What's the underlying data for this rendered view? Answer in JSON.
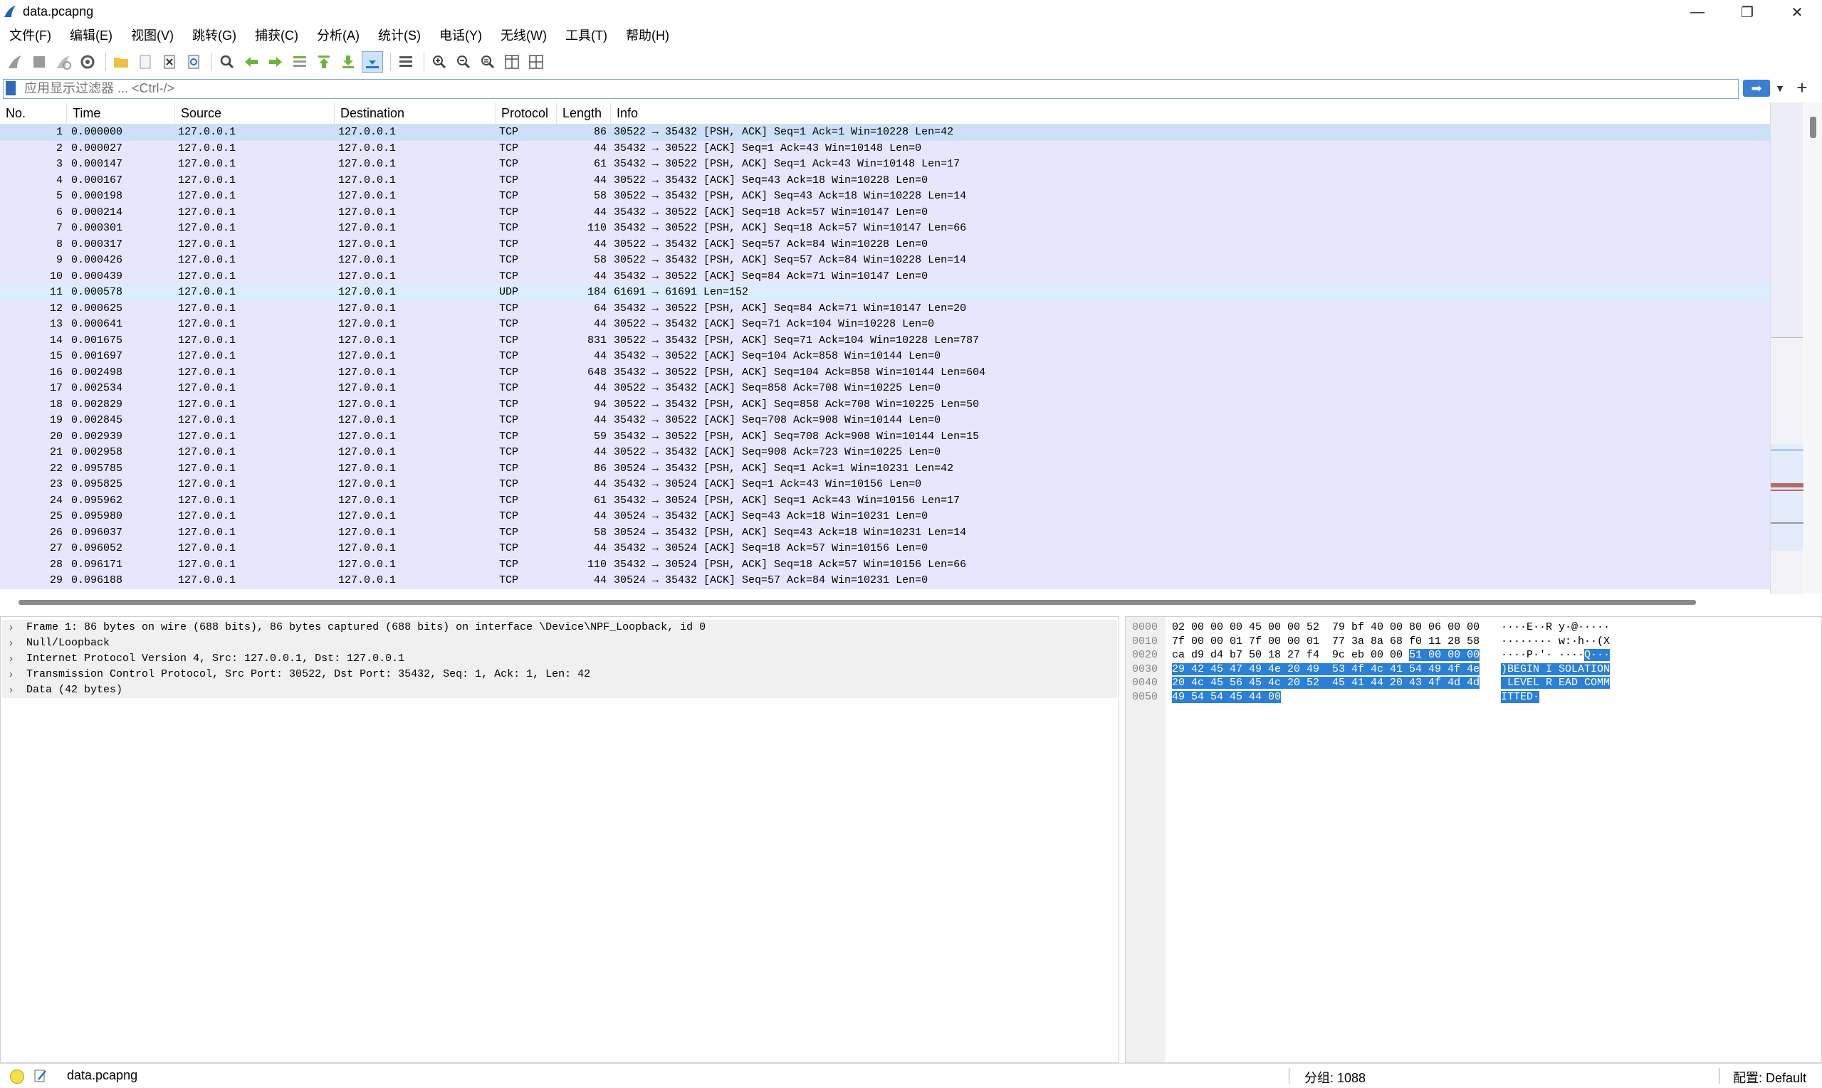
{
  "window": {
    "title": "data.pcapng",
    "minimize": "—",
    "restore": "❐",
    "close": "✕"
  },
  "menu": [
    "文件(F)",
    "编辑(E)",
    "视图(V)",
    "跳转(G)",
    "捕获(C)",
    "分析(A)",
    "统计(S)",
    "电话(Y)",
    "无线(W)",
    "工具(T)",
    "帮助(H)"
  ],
  "filter": {
    "placeholder": "应用显示过滤器 ... <Ctrl-/>",
    "apply_icon": "arrow-right-icon",
    "add_label": "+"
  },
  "columns": [
    "No.",
    "Time",
    "Source",
    "Destination",
    "Protocol",
    "Length",
    "Info"
  ],
  "packets": [
    {
      "no": "1",
      "time": "0.000000",
      "src": "127.0.0.1",
      "dst": "127.0.0.1",
      "proto": "TCP",
      "len": "86",
      "info": "30522 → 35432 [PSH, ACK] Seq=1 Ack=1 Win=10228 Len=42"
    },
    {
      "no": "2",
      "time": "0.000027",
      "src": "127.0.0.1",
      "dst": "127.0.0.1",
      "proto": "TCP",
      "len": "44",
      "info": "35432 → 30522 [ACK] Seq=1 Ack=43 Win=10148 Len=0"
    },
    {
      "no": "3",
      "time": "0.000147",
      "src": "127.0.0.1",
      "dst": "127.0.0.1",
      "proto": "TCP",
      "len": "61",
      "info": "35432 → 30522 [PSH, ACK] Seq=1 Ack=43 Win=10148 Len=17"
    },
    {
      "no": "4",
      "time": "0.000167",
      "src": "127.0.0.1",
      "dst": "127.0.0.1",
      "proto": "TCP",
      "len": "44",
      "info": "30522 → 35432 [ACK] Seq=43 Ack=18 Win=10228 Len=0"
    },
    {
      "no": "5",
      "time": "0.000198",
      "src": "127.0.0.1",
      "dst": "127.0.0.1",
      "proto": "TCP",
      "len": "58",
      "info": "30522 → 35432 [PSH, ACK] Seq=43 Ack=18 Win=10228 Len=14"
    },
    {
      "no": "6",
      "time": "0.000214",
      "src": "127.0.0.1",
      "dst": "127.0.0.1",
      "proto": "TCP",
      "len": "44",
      "info": "35432 → 30522 [ACK] Seq=18 Ack=57 Win=10147 Len=0"
    },
    {
      "no": "7",
      "time": "0.000301",
      "src": "127.0.0.1",
      "dst": "127.0.0.1",
      "proto": "TCP",
      "len": "110",
      "info": "35432 → 30522 [PSH, ACK] Seq=18 Ack=57 Win=10147 Len=66"
    },
    {
      "no": "8",
      "time": "0.000317",
      "src": "127.0.0.1",
      "dst": "127.0.0.1",
      "proto": "TCP",
      "len": "44",
      "info": "30522 → 35432 [ACK] Seq=57 Ack=84 Win=10228 Len=0"
    },
    {
      "no": "9",
      "time": "0.000426",
      "src": "127.0.0.1",
      "dst": "127.0.0.1",
      "proto": "TCP",
      "len": "58",
      "info": "30522 → 35432 [PSH, ACK] Seq=57 Ack=84 Win=10228 Len=14"
    },
    {
      "no": "10",
      "time": "0.000439",
      "src": "127.0.0.1",
      "dst": "127.0.0.1",
      "proto": "TCP",
      "len": "44",
      "info": "35432 → 30522 [ACK] Seq=84 Ack=71 Win=10147 Len=0"
    },
    {
      "no": "11",
      "time": "0.000578",
      "src": "127.0.0.1",
      "dst": "127.0.0.1",
      "proto": "UDP",
      "len": "184",
      "info": "61691 → 61691 Len=152"
    },
    {
      "no": "12",
      "time": "0.000625",
      "src": "127.0.0.1",
      "dst": "127.0.0.1",
      "proto": "TCP",
      "len": "64",
      "info": "35432 → 30522 [PSH, ACK] Seq=84 Ack=71 Win=10147 Len=20"
    },
    {
      "no": "13",
      "time": "0.000641",
      "src": "127.0.0.1",
      "dst": "127.0.0.1",
      "proto": "TCP",
      "len": "44",
      "info": "30522 → 35432 [ACK] Seq=71 Ack=104 Win=10228 Len=0"
    },
    {
      "no": "14",
      "time": "0.001675",
      "src": "127.0.0.1",
      "dst": "127.0.0.1",
      "proto": "TCP",
      "len": "831",
      "info": "30522 → 35432 [PSH, ACK] Seq=71 Ack=104 Win=10228 Len=787"
    },
    {
      "no": "15",
      "time": "0.001697",
      "src": "127.0.0.1",
      "dst": "127.0.0.1",
      "proto": "TCP",
      "len": "44",
      "info": "35432 → 30522 [ACK] Seq=104 Ack=858 Win=10144 Len=0"
    },
    {
      "no": "16",
      "time": "0.002498",
      "src": "127.0.0.1",
      "dst": "127.0.0.1",
      "proto": "TCP",
      "len": "648",
      "info": "35432 → 30522 [PSH, ACK] Seq=104 Ack=858 Win=10144 Len=604"
    },
    {
      "no": "17",
      "time": "0.002534",
      "src": "127.0.0.1",
      "dst": "127.0.0.1",
      "proto": "TCP",
      "len": "44",
      "info": "30522 → 35432 [ACK] Seq=858 Ack=708 Win=10225 Len=0"
    },
    {
      "no": "18",
      "time": "0.002829",
      "src": "127.0.0.1",
      "dst": "127.0.0.1",
      "proto": "TCP",
      "len": "94",
      "info": "30522 → 35432 [PSH, ACK] Seq=858 Ack=708 Win=10225 Len=50"
    },
    {
      "no": "19",
      "time": "0.002845",
      "src": "127.0.0.1",
      "dst": "127.0.0.1",
      "proto": "TCP",
      "len": "44",
      "info": "35432 → 30522 [ACK] Seq=708 Ack=908 Win=10144 Len=0"
    },
    {
      "no": "20",
      "time": "0.002939",
      "src": "127.0.0.1",
      "dst": "127.0.0.1",
      "proto": "TCP",
      "len": "59",
      "info": "35432 → 30522 [PSH, ACK] Seq=708 Ack=908 Win=10144 Len=15"
    },
    {
      "no": "21",
      "time": "0.002958",
      "src": "127.0.0.1",
      "dst": "127.0.0.1",
      "proto": "TCP",
      "len": "44",
      "info": "30522 → 35432 [ACK] Seq=908 Ack=723 Win=10225 Len=0"
    },
    {
      "no": "22",
      "time": "0.095785",
      "src": "127.0.0.1",
      "dst": "127.0.0.1",
      "proto": "TCP",
      "len": "86",
      "info": "30524 → 35432 [PSH, ACK] Seq=1 Ack=1 Win=10231 Len=42"
    },
    {
      "no": "23",
      "time": "0.095825",
      "src": "127.0.0.1",
      "dst": "127.0.0.1",
      "proto": "TCP",
      "len": "44",
      "info": "35432 → 30524 [ACK] Seq=1 Ack=43 Win=10156 Len=0"
    },
    {
      "no": "24",
      "time": "0.095962",
      "src": "127.0.0.1",
      "dst": "127.0.0.1",
      "proto": "TCP",
      "len": "61",
      "info": "35432 → 30524 [PSH, ACK] Seq=1 Ack=43 Win=10156 Len=17"
    },
    {
      "no": "25",
      "time": "0.095980",
      "src": "127.0.0.1",
      "dst": "127.0.0.1",
      "proto": "TCP",
      "len": "44",
      "info": "30524 → 35432 [ACK] Seq=43 Ack=18 Win=10231 Len=0"
    },
    {
      "no": "26",
      "time": "0.096037",
      "src": "127.0.0.1",
      "dst": "127.0.0.1",
      "proto": "TCP",
      "len": "58",
      "info": "30524 → 35432 [PSH, ACK] Seq=43 Ack=18 Win=10231 Len=14"
    },
    {
      "no": "27",
      "time": "0.096052",
      "src": "127.0.0.1",
      "dst": "127.0.0.1",
      "proto": "TCP",
      "len": "44",
      "info": "35432 → 30524 [ACK] Seq=18 Ack=57 Win=10156 Len=0"
    },
    {
      "no": "28",
      "time": "0.096171",
      "src": "127.0.0.1",
      "dst": "127.0.0.1",
      "proto": "TCP",
      "len": "110",
      "info": "35432 → 30524 [PSH, ACK] Seq=18 Ack=57 Win=10156 Len=66"
    },
    {
      "no": "29",
      "time": "0.096188",
      "src": "127.0.0.1",
      "dst": "127.0.0.1",
      "proto": "TCP",
      "len": "44",
      "info": "30524 → 35432 [ACK] Seq=57 Ack=84 Win=10231 Len=0"
    }
  ],
  "details": [
    "Frame 1: 86 bytes on wire (688 bits), 86 bytes captured (688 bits) on interface \\Device\\NPF_Loopback, id 0",
    "Null/Loopback",
    "Internet Protocol Version 4, Src: 127.0.0.1, Dst: 127.0.0.1",
    "Transmission Control Protocol, Src Port: 30522, Dst Port: 35432, Seq: 1, Ack: 1, Len: 42",
    "Data (42 bytes)"
  ],
  "bytes": [
    {
      "offset": "0000",
      "hex_plain": "02 00 00 00 45 00 00 52  79 bf 40 00 80 06 00 00",
      "hex_hl": "",
      "ascii_plain": "····E··R y·@·····",
      "ascii_hl": ""
    },
    {
      "offset": "0010",
      "hex_plain": "7f 00 00 01 7f 00 00 01  77 3a 8a 68 f0 11 28 58",
      "hex_hl": "",
      "ascii_plain": "········ w:·h··(X",
      "ascii_hl": ""
    },
    {
      "offset": "0020",
      "hex_plain": "ca d9 d4 b7 50 18 27 f4  9c eb 00 00 ",
      "hex_hl": "51 00 00 00",
      "ascii_plain": "····P·'· ····",
      "ascii_hl": "Q···"
    },
    {
      "offset": "0030",
      "hex_plain": "",
      "hex_hl": "29 42 45 47 49 4e 20 49  53 4f 4c 41 54 49 4f 4e",
      "ascii_plain": "",
      "ascii_hl": ")BEGIN I SOLATION"
    },
    {
      "offset": "0040",
      "hex_plain": "",
      "hex_hl": "20 4c 45 56 45 4c 20 52  45 41 44 20 43 4f 4d 4d",
      "ascii_plain": "",
      "ascii_hl": " LEVEL R EAD COMM"
    },
    {
      "offset": "0050",
      "hex_plain": "",
      "hex_hl": "49 54 54 45 44 00",
      "ascii_plain": "",
      "ascii_hl": "ITTED·"
    }
  ],
  "status": {
    "file": "data.pcapng",
    "packets": "分组: 1088",
    "profile": "配置: Default"
  },
  "colors": {
    "tcp_row": "#e7e6ff",
    "udp_row": "#daeeff",
    "selected_row": "#cce0fa",
    "bytes_highlight": "#2a7fd6"
  }
}
